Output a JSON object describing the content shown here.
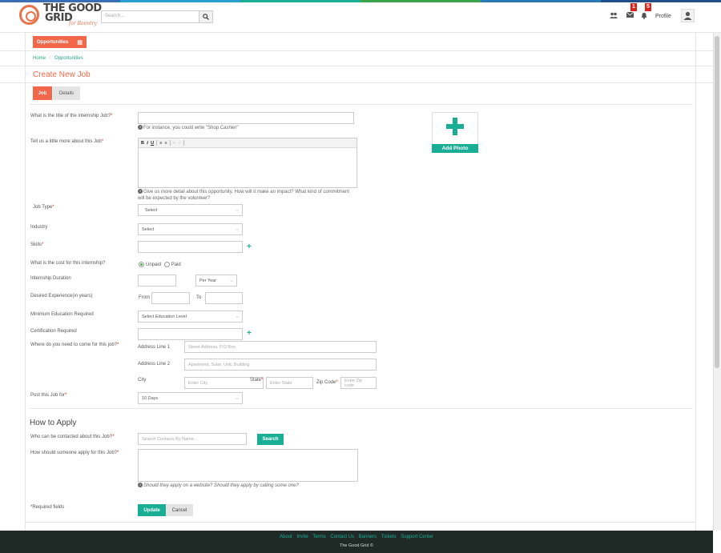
{
  "brand": {
    "line1": "THE GOOD",
    "line2": "GRID",
    "tagline": "for Reentry"
  },
  "colors": {
    "accent": "#f2674a",
    "teal": "#1aae96",
    "badge": "#d9231d",
    "footer_bg": "#1f2a27"
  },
  "header": {
    "search_placeholder": "Search...",
    "icons": [
      "users-icon",
      "envelope-icon",
      "bell-icon"
    ],
    "messages_count": "1",
    "notifications_count": "5",
    "profile_label": "Profile"
  },
  "nav": {
    "opportunities_label": "Opportunities"
  },
  "breadcrumb": {
    "home": "Home",
    "separator": "/",
    "current": "Opportunities"
  },
  "page_title": "Create New Job",
  "tabs": {
    "job": "Job",
    "details": "Details"
  },
  "form": {
    "title_label": "What is the title of the internship Job?",
    "title_hint": "For instance, you could write \"Shop Cashier\"",
    "description_label": "Tell us a little more about this Job",
    "description_hint": "Give us more detail about this opportunity. How will it make an impact? What kind of commitment will be expected by the volunteer?",
    "job_type_label": "Job Type",
    "job_type_value": "Select",
    "industry_label": "Industry",
    "industry_value": "Select",
    "skills_label": "Skills",
    "cost_label": "What is the cost for this internship?",
    "cost_unpaid": "Unpaid",
    "cost_paid": "Paid",
    "duration_label": "Internship Duration",
    "duration_unit": "Per Year",
    "experience_label": "Desired Experience(in years)",
    "experience_from": "From",
    "experience_to": "To",
    "education_label": "Minimum Education Required",
    "education_value": "Select Education Level",
    "certification_label": "Certification Required",
    "location_label": "Where do you need to come for this job?",
    "address1_label": "Address Line 1",
    "address1_placeholder": "Street Address, P.O Box",
    "address2_label": "Address Line 2",
    "address2_placeholder": "Apartment, Suite, Unit, Building",
    "city_label": "City",
    "city_placeholder": "Enter City",
    "state_label": "State",
    "state_placeholder": "Enter State",
    "zip_label": "Zip Code",
    "zip_placeholder": "Enter Zip code",
    "post_for_label": "Post this Job for",
    "post_for_value": "10 Days",
    "required_marker": "*"
  },
  "photo": {
    "label": "Add Photo"
  },
  "apply": {
    "heading": "How to Apply",
    "contact_label": "Who can be contacted about this Job?",
    "contact_placeholder": "Search Contacts By  Name...",
    "search_button": "Search",
    "how_label": "How should someone apply for this Job?",
    "how_hint": "Should they apply on a website? Should they apply by calling some one?"
  },
  "actions": {
    "required_note": "*Required fields",
    "update": "Update",
    "cancel": "Cancel"
  },
  "footer": {
    "links": [
      "About",
      "Invite",
      "Terms",
      "Contact Us",
      "Banners",
      "Tickets",
      "Support Center"
    ],
    "copyright": "The Good Grid ©"
  }
}
